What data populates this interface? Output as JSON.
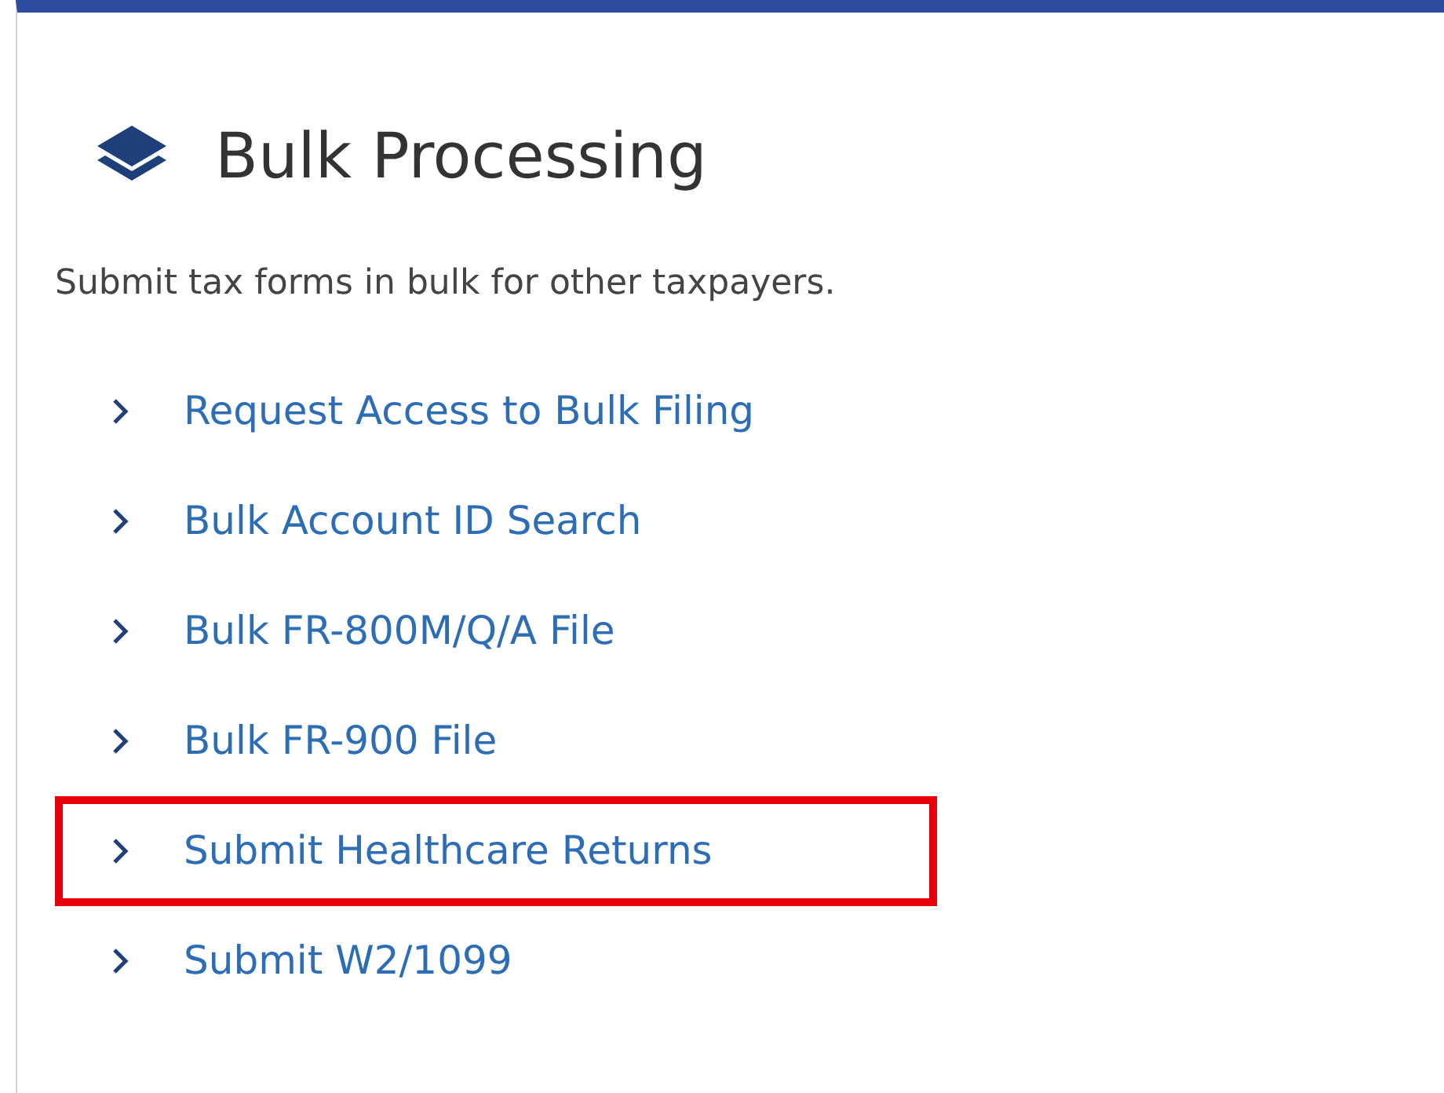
{
  "title": "Bulk Processing",
  "description": "Submit tax forms in bulk for other taxpayers.",
  "links": [
    {
      "label": "Request Access to Bulk Filing",
      "highlighted": false
    },
    {
      "label": "Bulk Account ID Search",
      "highlighted": false
    },
    {
      "label": "Bulk FR-800M/Q/A File",
      "highlighted": false
    },
    {
      "label": "Bulk FR-900 File",
      "highlighted": false
    },
    {
      "label": "Submit Healthcare Returns",
      "highlighted": true
    },
    {
      "label": "Submit W2/1099",
      "highlighted": false
    }
  ]
}
